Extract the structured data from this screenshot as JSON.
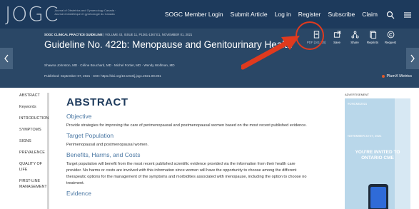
{
  "nav": {
    "logo": "JOGC",
    "logo_tagline": "Journal of Obstetrics and Gynaecology Canada · Journal d'obstétrique et gynécologie du Canada",
    "links": [
      "SOGC Member Login",
      "Submit Article",
      "Log in",
      "Register",
      "Subscribe",
      "Claim"
    ]
  },
  "article": {
    "series_label": "SOGC CLINICAL PRACTICE GUIDELINE",
    "series_info": "| VOLUME 43, ISSUE 11, P1361-1367.E1, NOVEMBER 01, 2021",
    "title": "Guideline No. 422b: Menopause and Genitourinary Health",
    "authors": "Shawna Johnston, MD  ·  Céline Bouchard, MD · Michel Fortier, MD · Wendy Wolfman, MD",
    "published": "Published: September 07, 2021 · DOI: https://doi.org/10.1016/j.jogc.2021.09.001",
    "plumx": "PlumX Metrics"
  },
  "actions": {
    "pdf": "PDF [161 KB]",
    "save": "Save",
    "share": "Share",
    "reprints": "Reprints",
    "request": "Request"
  },
  "sidebar": {
    "items": [
      "ABSTRACT",
      "Keywords",
      "INTRODUCTION",
      "SYMPTOMS",
      "SIGNS",
      "PREVALENCE",
      "QUALITY OF LIFE",
      "FIRST-LINE MANAGEMENT"
    ]
  },
  "main": {
    "heading": "ABSTRACT",
    "objective_heading": "Objective",
    "objective_text": "Provide strategies for improving the care of perimenopausal and postmenopausal women based on the most recent published evidence.",
    "target_heading": "Target Population",
    "target_text": "Perimenopausal and postmenopausal women.",
    "benefits_heading": "Benefits, Harms, and Costs",
    "benefits_text": "Target population will benefit from the most recent published scientific evidence provided via the information from their health care provider. No harms or costs are involved with this information since women will have the opportunity to choose among the different therapeutic options for the management of the symptoms and morbidities associated with menopause, including the option to choose no treatment.",
    "evidence_heading": "Evidence"
  },
  "ad": {
    "label": "ADVERTISEMENT",
    "hashtag": "#ONCME2021",
    "date": "NOVEMBER 22-27, 2021",
    "invite": "YOU'RE INVITED TO ONTARIO CME"
  },
  "colors": {
    "nav_bg": "#1d3a5c",
    "banner_bg": "#2a4766",
    "heading": "#1d3a5c",
    "subheading": "#4a77a3",
    "annotation": "#e03a1e"
  }
}
